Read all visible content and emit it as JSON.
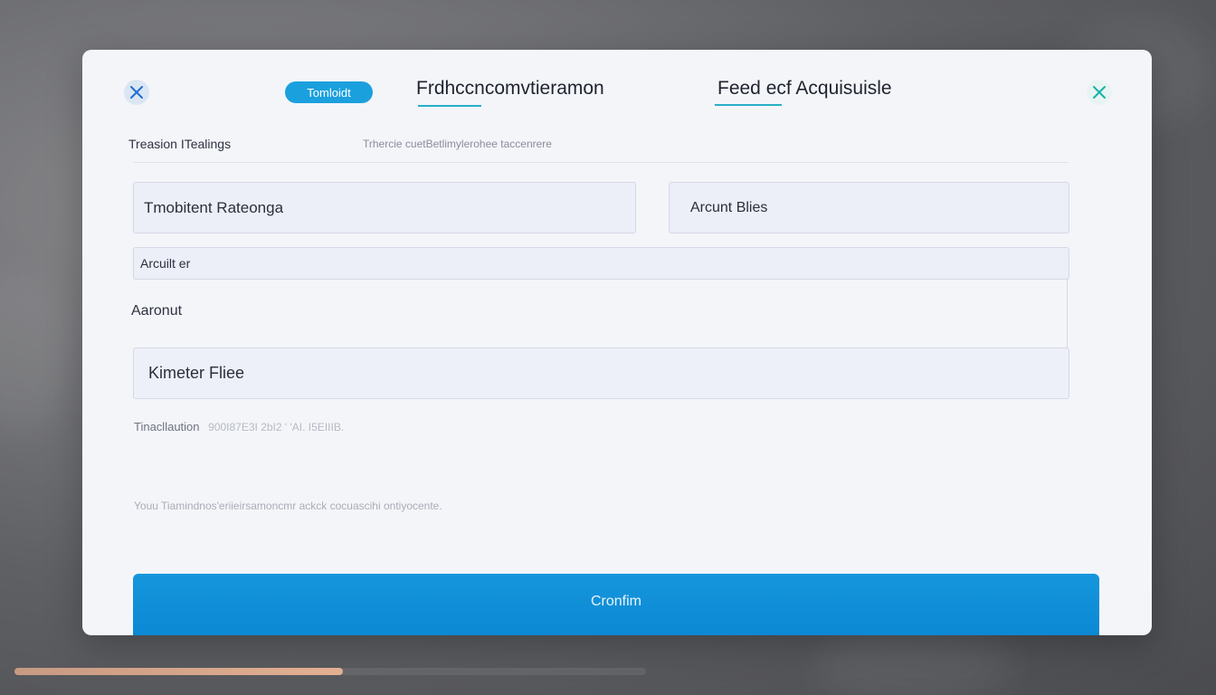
{
  "dialog": {
    "pill_label": "Tomloidt",
    "tabs": [
      {
        "label": "Frdhccncomvtieramon"
      },
      {
        "label": "Feed ecf Acquisuisle"
      }
    ],
    "subheader": {
      "left": "Treasion ITealings",
      "right": "Trhercie cuetBetlimylerohee taccenrere"
    },
    "fields": {
      "recipient": {
        "value": "Tmobitent Rateonga"
      },
      "amount_bills": {
        "value": "Arcunt Blies"
      },
      "amount": {
        "value": "Arcuilt er"
      },
      "section_label": "Aaronut",
      "member_file": {
        "value": "Kimeter Fliee"
      }
    },
    "meta": {
      "label": "Tinacllaution",
      "value": "900I87E3I 2bI2 ' 'AI. I5EIIIB."
    },
    "note": "Youu Tiamindnos'eriieirsamoncmr ackck cocuascihi ontiyocente.",
    "confirm_label": "Cronfim"
  },
  "progress": {
    "fraction": 0.52
  },
  "colors": {
    "accent": "#1ba0de",
    "confirm": "#0a86d2",
    "progress": "#e3b092",
    "tab_underline": "#27b0c8"
  },
  "icons": {
    "close_left": "close-icon",
    "close_right": "close-icon"
  }
}
